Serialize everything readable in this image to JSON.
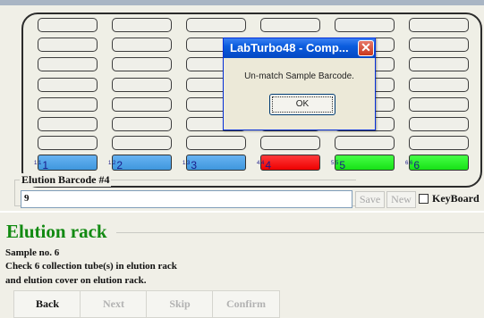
{
  "rack": {
    "positions": [
      {
        "sub": "1.1",
        "label": "1",
        "color": "#4aa2e8",
        "status": "blue"
      },
      {
        "sub": "1.2",
        "label": "2",
        "color": "#4aa2e8",
        "status": "blue"
      },
      {
        "sub": "1.3",
        "label": "3",
        "color": "#4aa2e8",
        "status": "blue"
      },
      {
        "sub": "4.4",
        "label": "4",
        "color": "#ff0000",
        "status": "red"
      },
      {
        "sub": "5.5",
        "label": "5",
        "color": "#22ee22",
        "status": "green"
      },
      {
        "sub": "6.6",
        "label": "6",
        "color": "#22ee22",
        "status": "green"
      }
    ]
  },
  "barcode": {
    "legend": "Elution Barcode #4",
    "value": "9",
    "save_label": "Save",
    "new_label": "New",
    "keyboard_label": "KeyBoard"
  },
  "elution": {
    "title": "Elution rack",
    "sample_line": "Sample no. 6",
    "check_line": "Check 6 collection tube(s) in elution rack",
    "cover_line": "and elution cover on elution rack."
  },
  "nav": {
    "back": "Back",
    "next": "Next",
    "skip": "Skip",
    "confirm": "Confirm"
  },
  "dialog": {
    "title": "LabTurbo48 - Comp...",
    "message": "Un-match Sample Barcode.",
    "ok": "OK"
  },
  "colors": {
    "title_green": "#128a12",
    "dialog_titlebar": "#0b5cdd"
  }
}
